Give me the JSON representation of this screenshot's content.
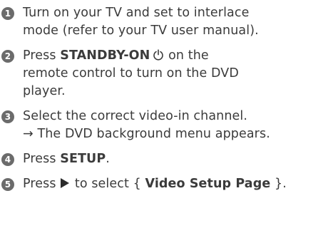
{
  "steps": [
    {
      "num": "1",
      "line1": "Turn on your TV and set to interlace",
      "line2": "mode (refer to your TV user manual)."
    },
    {
      "num": "2",
      "pre": "Press ",
      "bold": "STANDBY-ON",
      "line2": "remote control to turn on the DVD",
      "line3": "player.",
      "tail": " on the"
    },
    {
      "num": "3",
      "line1": "Select the correct video-in channel.",
      "result": "The DVD background menu appears.",
      "result_arrow": "→"
    },
    {
      "num": "4",
      "pre": "Press ",
      "bold": "SETUP",
      "post": "."
    },
    {
      "num": "5",
      "pre": "Press ",
      "mid": " to select { ",
      "bold": "Video Setup Page",
      "post": " }."
    }
  ],
  "icons": {
    "power": "power-icon",
    "play": "play-arrow-icon",
    "badge_color": "#6b6b6b"
  }
}
